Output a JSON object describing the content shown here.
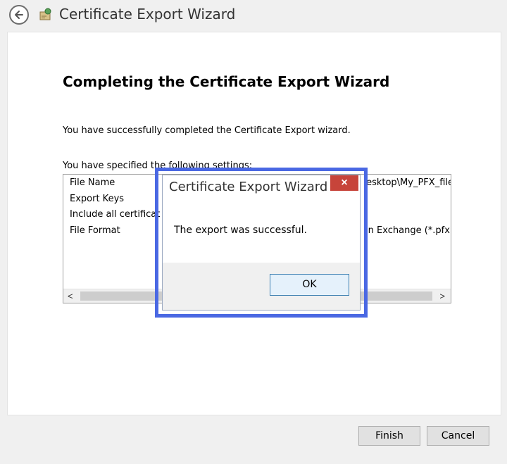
{
  "window": {
    "title": "Certificate Export Wizard"
  },
  "page": {
    "heading": "Completing the Certificate Export Wizard",
    "success_text": "You have successfully completed the Certificate Export wizard.",
    "settings_intro": "You have specified the following settings:"
  },
  "settings": {
    "rows": [
      {
        "label": "File Name",
        "value": "esktop\\My_PFX_file"
      },
      {
        "label": "Export Keys",
        "value": ""
      },
      {
        "label": "Include all certificat",
        "value": ""
      },
      {
        "label": "File Format",
        "value": "n Exchange (*.pfx)"
      }
    ],
    "scroll_left": "<",
    "scroll_right": ">"
  },
  "footer": {
    "finish_label": "Finish",
    "cancel_label": "Cancel"
  },
  "dialog": {
    "title": "Certificate Export Wizard",
    "close_glyph": "×",
    "message": "The export was successful.",
    "ok_label": "OK"
  },
  "colors": {
    "highlight_border": "#4a68e3",
    "close_button": "#c7443a"
  }
}
